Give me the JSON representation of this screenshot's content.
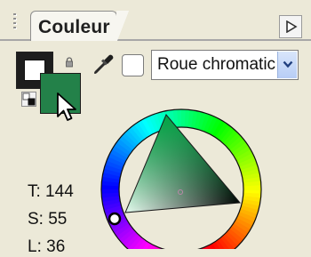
{
  "panel": {
    "title": "Couleur",
    "options_icon": "menu-arrow-icon"
  },
  "colors": {
    "foreground": "#238149",
    "background": "#1d1d1d",
    "panel_bg": "#ece9d8"
  },
  "tools": {
    "eyedropper": "eyedropper-icon",
    "lock": "lock-icon",
    "reset": "reset-colors-icon"
  },
  "model_select": {
    "value": "Roue chromatic"
  },
  "hsl": {
    "hue": "T: 144",
    "saturation": "S: 55",
    "lightness": "L: 36"
  }
}
